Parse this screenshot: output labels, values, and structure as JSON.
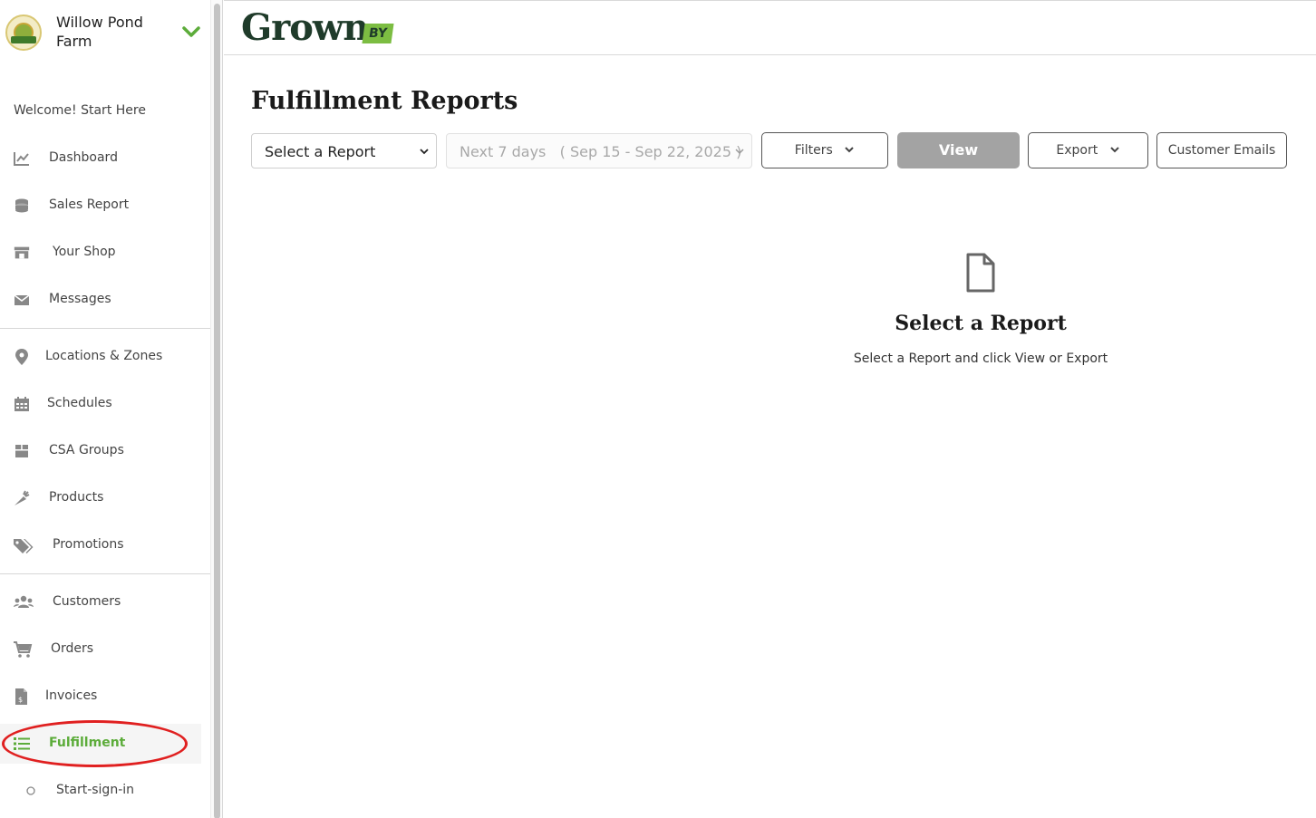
{
  "sidebar": {
    "farm_name": "Willow Pond Farm",
    "welcome": "Welcome! Start Here",
    "items": [
      {
        "label": "Dashboard",
        "icon": "chart-line-icon"
      },
      {
        "label": "Sales Report",
        "icon": "coins-icon"
      },
      {
        "label": "Your Shop",
        "icon": "store-icon"
      },
      {
        "label": "Messages",
        "icon": "envelope-icon"
      },
      {
        "label": "Locations & Zones",
        "icon": "map-pin-icon"
      },
      {
        "label": "Schedules",
        "icon": "calendar-icon"
      },
      {
        "label": "CSA Groups",
        "icon": "box-icon"
      },
      {
        "label": "Products",
        "icon": "carrot-icon"
      },
      {
        "label": "Promotions",
        "icon": "tags-icon"
      },
      {
        "label": "Customers",
        "icon": "users-icon"
      },
      {
        "label": "Orders",
        "icon": "cart-icon"
      },
      {
        "label": "Invoices",
        "icon": "invoice-icon"
      },
      {
        "label": "Fulfillment",
        "icon": "list-icon",
        "active": true
      },
      {
        "label": "Start-sign-in",
        "icon": "circle-icon"
      }
    ]
  },
  "header": {
    "brand": "Grown",
    "brand_suffix": "BY"
  },
  "main": {
    "title": "Fulfillment Reports",
    "report_select": "Select a Report",
    "date_range_label": "Next 7 days",
    "date_range_dates": "( Sep 15 - Sep 22, 2025 )",
    "filters_label": "Filters",
    "view_label": "View",
    "export_label": "Export",
    "customer_emails_label": "Customer Emails",
    "empty_title": "Select a Report",
    "empty_subtitle": "Select a Report and click View or Export"
  },
  "colors": {
    "accent_green": "#5cac3a",
    "brand_dark": "#1f3b2a",
    "annotation_red": "#e02020"
  }
}
